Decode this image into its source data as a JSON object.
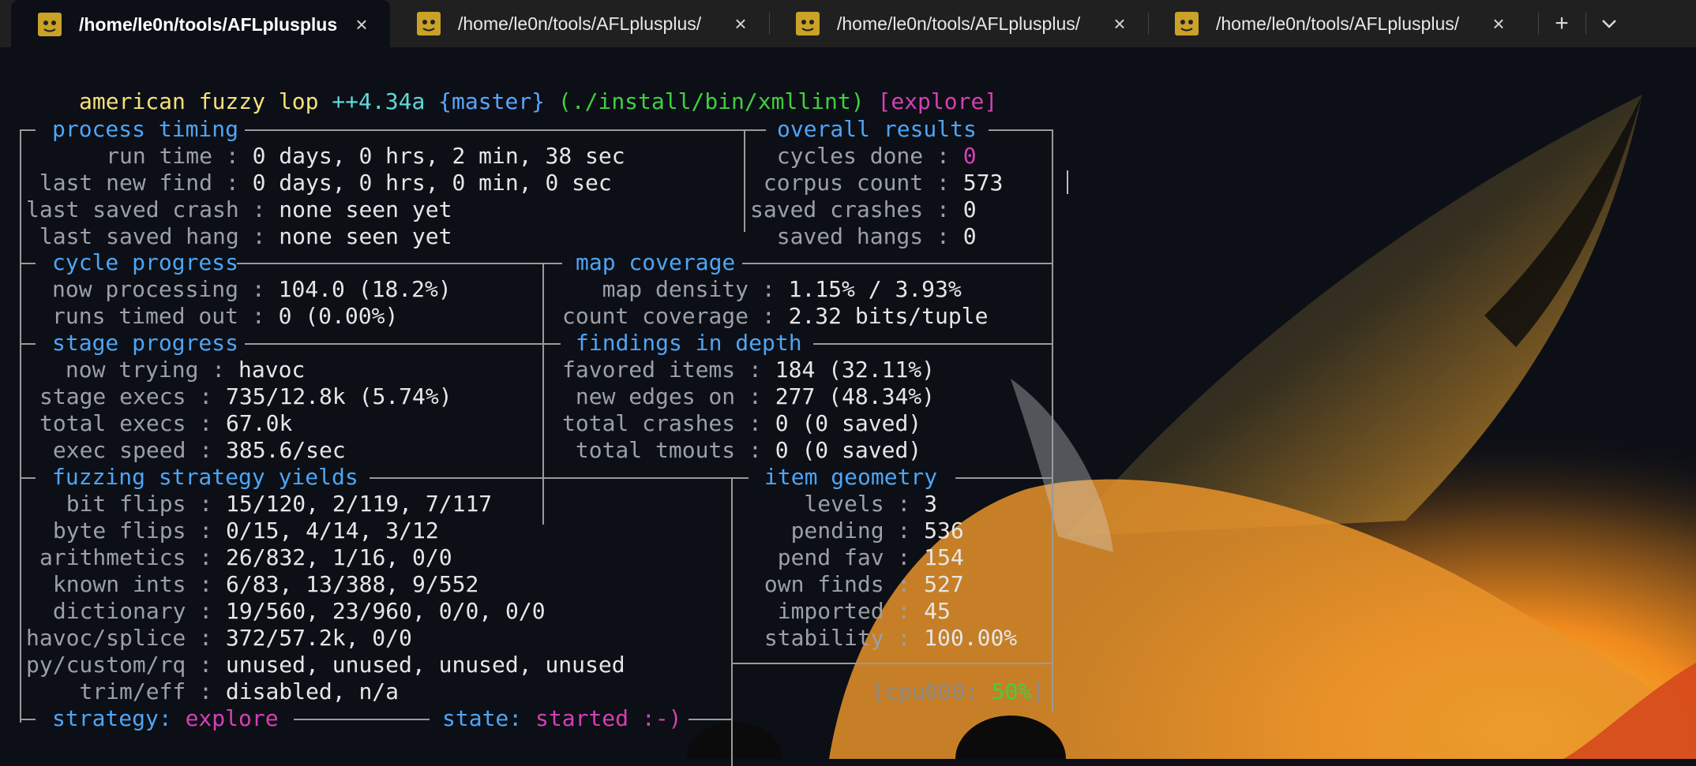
{
  "tabs": [
    {
      "title": "/home/le0n/tools/AFLplusplus"
    },
    {
      "title": "/home/le0n/tools/AFLplusplus/"
    },
    {
      "title": "/home/le0n/tools/AFLplusplus/"
    },
    {
      "title": "/home/le0n/tools/AFLplusplus/"
    }
  ],
  "tab_icons": {
    "close": "×",
    "new_tab": "+",
    "dropdown": "⌄"
  },
  "banner": {
    "app": "american fuzzy lop",
    "version": "++4.34a",
    "branch": "{master}",
    "target": "(./install/bin/xmllint)",
    "mode": "[explore]"
  },
  "process_timing": {
    "title": "process timing",
    "rows": [
      {
        "label": "      run time",
        "value": "0 days, 0 hrs, 2 min, 38 sec"
      },
      {
        "label": " last new find",
        "value": "0 days, 0 hrs, 0 min, 0 sec"
      },
      {
        "label": "last saved crash",
        "value": "none seen yet"
      },
      {
        "label": " last saved hang",
        "value": "none seen yet"
      }
    ]
  },
  "overall_results": {
    "title": "overall results",
    "rows": [
      {
        "label": "  cycles done",
        "value": "0"
      },
      {
        "label": " corpus count",
        "value": "573"
      },
      {
        "label": "saved crashes",
        "value": "0"
      },
      {
        "label": "  saved hangs",
        "value": "0"
      }
    ]
  },
  "cycle_progress": {
    "title": "cycle progress",
    "rows": [
      {
        "label": "now processing",
        "value": "104.0 (18.2%)"
      },
      {
        "label": "runs timed out",
        "value": "0 (0.00%)"
      }
    ]
  },
  "map_coverage": {
    "title": "map coverage",
    "rows": [
      {
        "label": "   map density",
        "value": "1.15% / 3.93%"
      },
      {
        "label": "count coverage",
        "value": "2.32 bits/tuple"
      }
    ]
  },
  "stage_progress": {
    "title": "stage progress",
    "rows": [
      {
        "label": " now trying",
        "value": "havoc"
      },
      {
        "label": "stage execs",
        "value": "735/12.8k (5.74%)"
      },
      {
        "label": "total execs",
        "value": "67.0k"
      },
      {
        "label": " exec speed",
        "value": "385.6/sec"
      }
    ]
  },
  "findings_in_depth": {
    "title": "findings in depth",
    "rows": [
      {
        "label": "favored items",
        "value": "184 (32.11%)"
      },
      {
        "label": " new edges on",
        "value": "277 (48.34%)"
      },
      {
        "label": "total crashes",
        "value": "0 (0 saved)"
      },
      {
        "label": " total tmouts",
        "value": "0 (0 saved)"
      }
    ]
  },
  "fuzzing_strategy_yields": {
    "title": "fuzzing strategy yields",
    "rows": [
      {
        "label": "  bit flips",
        "value": "15/120, 2/119, 7/117"
      },
      {
        "label": " byte flips",
        "value": "0/15, 4/14, 3/12"
      },
      {
        "label": "arithmetics",
        "value": "26/832, 1/16, 0/0"
      },
      {
        "label": " known ints",
        "value": "6/83, 13/388, 9/552"
      },
      {
        "label": " dictionary",
        "value": "19/560, 23/960, 0/0, 0/0"
      },
      {
        "label": "havoc/splice",
        "value": "372/57.2k, 0/0"
      },
      {
        "label": "py/custom/rq",
        "value": "unused, unused, unused, unused"
      },
      {
        "label": "    trim/eff",
        "value": "disabled, n/a"
      }
    ]
  },
  "item_geometry": {
    "title": "item geometry",
    "rows": [
      {
        "label": "    levels",
        "value": "3"
      },
      {
        "label": "   pending",
        "value": "536"
      },
      {
        "label": "  pend fav",
        "value": "154"
      },
      {
        "label": " own finds",
        "value": "527"
      },
      {
        "label": "  imported",
        "value": "45"
      },
      {
        "label": " stability",
        "value": "100.00%"
      }
    ]
  },
  "footer": {
    "strategy_label": "strategy:",
    "strategy_value": "explore",
    "state_label": "state:",
    "state_value": "started :-)",
    "cpu_label": "[cpu000:",
    "cpu_value": "50%",
    "cpu_close": "]"
  },
  "colors": {
    "header": "#4ea5f5",
    "label": "#9aa0a6",
    "value": "#e6e6e6",
    "magenta": "#d63fb5",
    "green": "#3fd03f",
    "border": "#9a9a9a"
  }
}
